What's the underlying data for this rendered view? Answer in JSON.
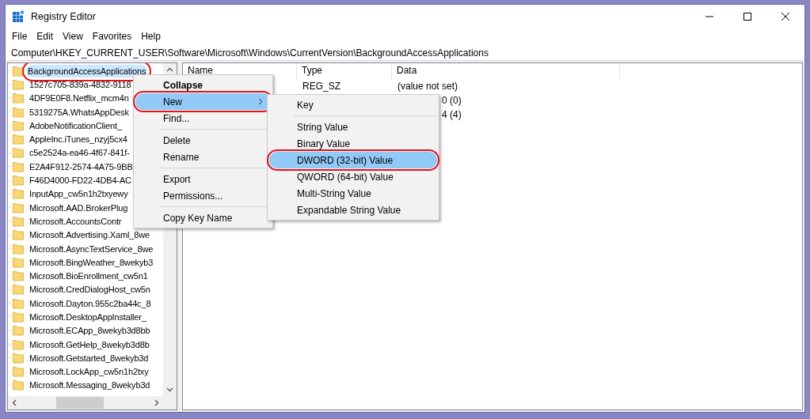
{
  "window": {
    "title": "Registry Editor"
  },
  "menu_bar": [
    "File",
    "Edit",
    "View",
    "Favorites",
    "Help"
  ],
  "address": "Computer\\HKEY_CURRENT_USER\\Software\\Microsoft\\Windows\\CurrentVersion\\BackgroundAccessApplications",
  "tree": [
    {
      "label": "BackgroundAccessApplications",
      "selected": true,
      "annotated": true
    },
    {
      "label": "1527c705-839a-4832-9118",
      "selected": false
    },
    {
      "label": "4DF9E0F8.Netflix_mcm4n",
      "selected": false
    },
    {
      "label": "5319275A.WhatsAppDesk",
      "selected": false
    },
    {
      "label": "AdobeNotificationClient_",
      "selected": false
    },
    {
      "label": "AppleInc.iTunes_nzyj5cx4",
      "selected": false
    },
    {
      "label": "c5e2524a-ea46-4f67-841f-",
      "selected": false
    },
    {
      "label": "E2A4F912-2574-4A75-9BB",
      "selected": false
    },
    {
      "label": "F46D4000-FD22-4DB4-AC",
      "selected": false
    },
    {
      "label": "InputApp_cw5n1h2txyewy",
      "selected": false
    },
    {
      "label": "Microsoft.AAD.BrokerPlug",
      "selected": false
    },
    {
      "label": "Microsoft.AccountsContr",
      "selected": false
    },
    {
      "label": "Microsoft.Advertising.Xaml_8we",
      "selected": false
    },
    {
      "label": "Microsoft.AsyncTextService_8we",
      "selected": false
    },
    {
      "label": "Microsoft.BingWeather_8wekyb3",
      "selected": false
    },
    {
      "label": "Microsoft.BioEnrollment_cw5n1",
      "selected": false
    },
    {
      "label": "Microsoft.CredDialogHost_cw5n",
      "selected": false
    },
    {
      "label": "Microsoft.Dayton.955c2ba44c_8",
      "selected": false
    },
    {
      "label": "Microsoft.DesktopAppInstaller_",
      "selected": false
    },
    {
      "label": "Microsoft.ECApp_8wekyb3d8bb",
      "selected": false
    },
    {
      "label": "Microsoft.GetHelp_8wekyb3d8b",
      "selected": false
    },
    {
      "label": "Microsoft.Getstarted_8wekyb3d",
      "selected": false
    },
    {
      "label": "Microsoft.LockApp_cw5n1h2txy",
      "selected": false
    },
    {
      "label": "Microsoft.Messaging_8wekyb3d",
      "selected": false
    }
  ],
  "values_table": {
    "columns": [
      "Name",
      "Type",
      "Data"
    ],
    "rows": [
      {
        "type": "REG_SZ",
        "data": "(value not set)",
        "covered": false
      },
      {
        "data": "0 (0)",
        "covered": true
      },
      {
        "data": "4 (4)",
        "covered": true
      }
    ]
  },
  "context_menu": [
    {
      "kind": "item",
      "label": "Collapse",
      "default": true,
      "selected": false
    },
    {
      "kind": "item",
      "label": "New",
      "selected": true,
      "submenu": true,
      "annotated": true
    },
    {
      "kind": "item",
      "label": "Find...",
      "selected": false
    },
    {
      "kind": "separator"
    },
    {
      "kind": "item",
      "label": "Delete",
      "selected": false
    },
    {
      "kind": "item",
      "label": "Rename",
      "selected": false
    },
    {
      "kind": "separator"
    },
    {
      "kind": "item",
      "label": "Export",
      "selected": false
    },
    {
      "kind": "item",
      "label": "Permissions...",
      "selected": false
    },
    {
      "kind": "separator"
    },
    {
      "kind": "item",
      "label": "Copy Key Name",
      "selected": false
    }
  ],
  "submenu": [
    {
      "kind": "item",
      "label": "Key",
      "selected": false
    },
    {
      "kind": "separator"
    },
    {
      "kind": "item",
      "label": "String Value",
      "selected": false
    },
    {
      "kind": "item",
      "label": "Binary Value",
      "selected": false
    },
    {
      "kind": "item",
      "label": "DWORD (32-bit) Value",
      "selected": true,
      "annotated": true
    },
    {
      "kind": "item",
      "label": "QWORD (64-bit) Value",
      "selected": false
    },
    {
      "kind": "item",
      "label": "Multi-String Value",
      "selected": false
    },
    {
      "kind": "item",
      "label": "Expandable String Value",
      "selected": false
    }
  ]
}
